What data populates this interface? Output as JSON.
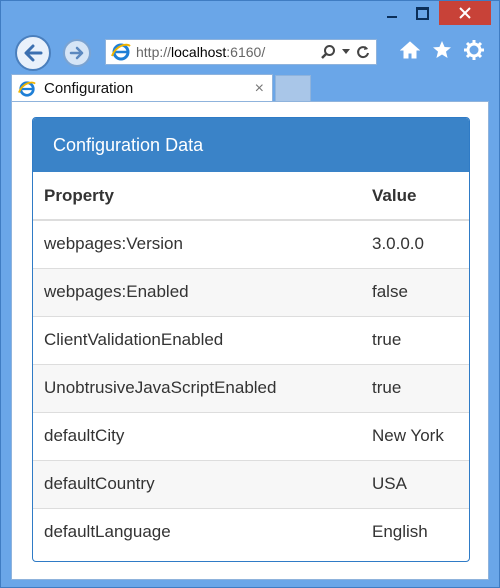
{
  "browser": {
    "url": {
      "prefix": "http://",
      "host": "localhost",
      "port": ":6160/"
    },
    "tab_title": "Configuration",
    "tab_close": "×"
  },
  "icons": {
    "back": "back-arrow-icon",
    "forward": "forward-arrow-icon",
    "ie": "internet-explorer-icon",
    "search": "search-icon",
    "refresh": "refresh-icon",
    "home": "home-icon",
    "favorites": "star-icon",
    "settings": "gear-icon"
  },
  "colors": {
    "window_frame": "#6aa6e8",
    "panel_heading": "#3a83c8",
    "close_button": "#c84238"
  },
  "panel": {
    "heading": "Configuration Data",
    "columns": [
      "Property",
      "Value"
    ],
    "rows": [
      [
        "webpages:Version",
        "3.0.0.0"
      ],
      [
        "webpages:Enabled",
        "false"
      ],
      [
        "ClientValidationEnabled",
        "true"
      ],
      [
        "UnobtrusiveJavaScriptEnabled",
        "true"
      ],
      [
        "defaultCity",
        "New York"
      ],
      [
        "defaultCountry",
        "USA"
      ],
      [
        "defaultLanguage",
        "English"
      ]
    ]
  }
}
